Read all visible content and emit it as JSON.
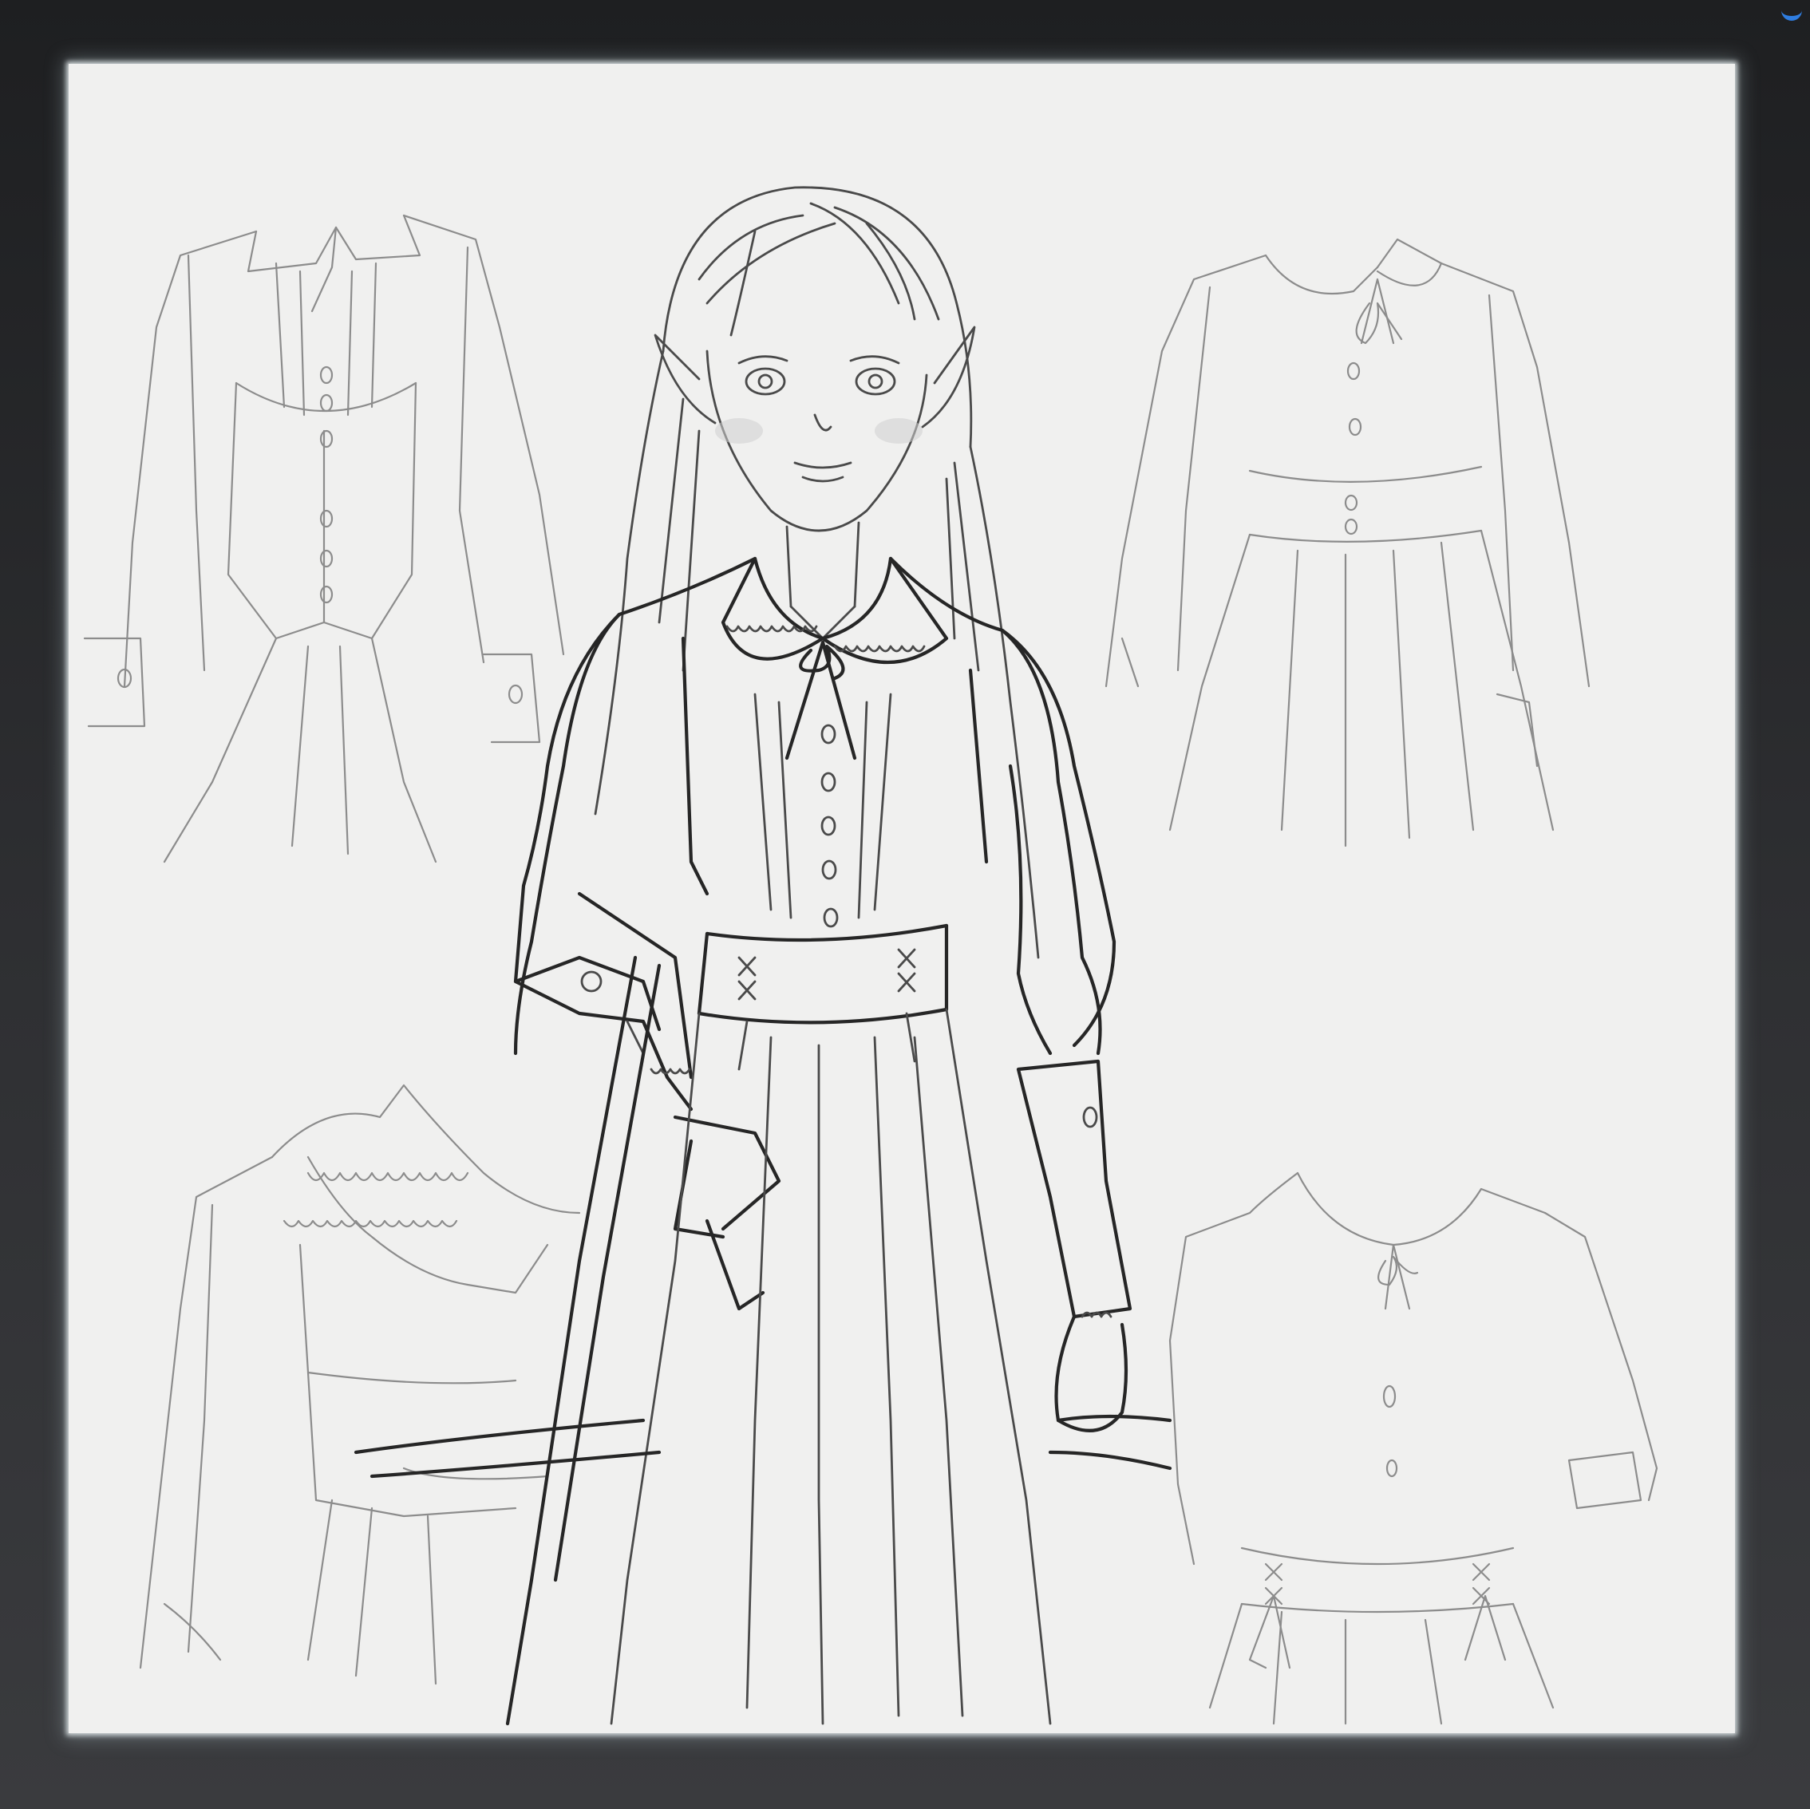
{
  "scene": {
    "subject": "pencil-sketch-outfit-design-on-tablet",
    "colors": {
      "paper": "#f0f0ef",
      "bezel": "#2b2c2e",
      "pencil_dark": "#262626",
      "pencil_light": "#8c8c8c",
      "accent_corner": "#2f7de0"
    },
    "sketches": [
      "central-elf-figure",
      "dress-top-left",
      "dress-top-right",
      "dress-bottom-left",
      "dress-bottom-right"
    ]
  }
}
